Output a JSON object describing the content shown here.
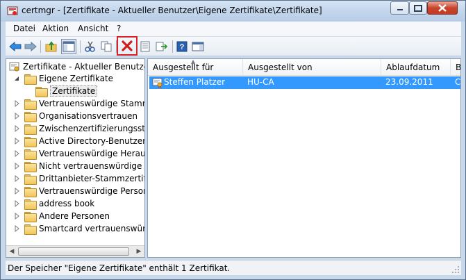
{
  "window": {
    "title": "certmgr - [Zertifikate - Aktueller Benutzer\\Eigene Zertifikate\\Zertifikate]"
  },
  "menu": {
    "file": "Datei",
    "action": "Aktion",
    "view": "Ansicht",
    "help": "?"
  },
  "toolbar": {
    "buttons": [
      "back-icon",
      "forward-icon",
      "up-folder-icon",
      "show-hide-console-tree-icon",
      "cut-icon",
      "copy-icon",
      "delete-icon",
      "properties-icon",
      "export-list-icon",
      "help-icon",
      "show-hide-action-pane-icon"
    ],
    "highlighted": "delete-icon"
  },
  "tree": {
    "root": "Zertifikate - Aktueller Benutzer",
    "items": [
      {
        "label": "Eigene Zertifikate",
        "expanded": true
      },
      {
        "label": "Zertifikate",
        "selected": true
      },
      {
        "label": "Vertrauenswürdige Stammzer"
      },
      {
        "label": "Organisationsvertrauen"
      },
      {
        "label": "Zwischenzertifizierungsstellen"
      },
      {
        "label": "Active Directory-Benutzerobj"
      },
      {
        "label": "Vertrauenswürdige Herausge"
      },
      {
        "label": "Nicht vertrauenswürdige Zert"
      },
      {
        "label": "Drittanbieter-Stammzertifizie"
      },
      {
        "label": "Vertrauenswürdige Personen"
      },
      {
        "label": "address book"
      },
      {
        "label": "Andere Personen"
      },
      {
        "label": "Smartcard vertrauenswürdige"
      }
    ]
  },
  "list": {
    "columns": [
      "Ausgestellt für",
      "Ausgestellt von",
      "Ablaufdatum",
      "B"
    ],
    "rows": [
      {
        "issued_to": "Steffen Platzer",
        "issued_by": "HU-CA",
        "expiry": "23.09.2011",
        "extra": "C"
      }
    ]
  },
  "status": {
    "text": "Der Speicher \"Eigene Zertifikate\" enthält 1 Zertifikat."
  },
  "colors": {
    "selection": "#3399ff",
    "highlight_border": "#d9232b"
  }
}
